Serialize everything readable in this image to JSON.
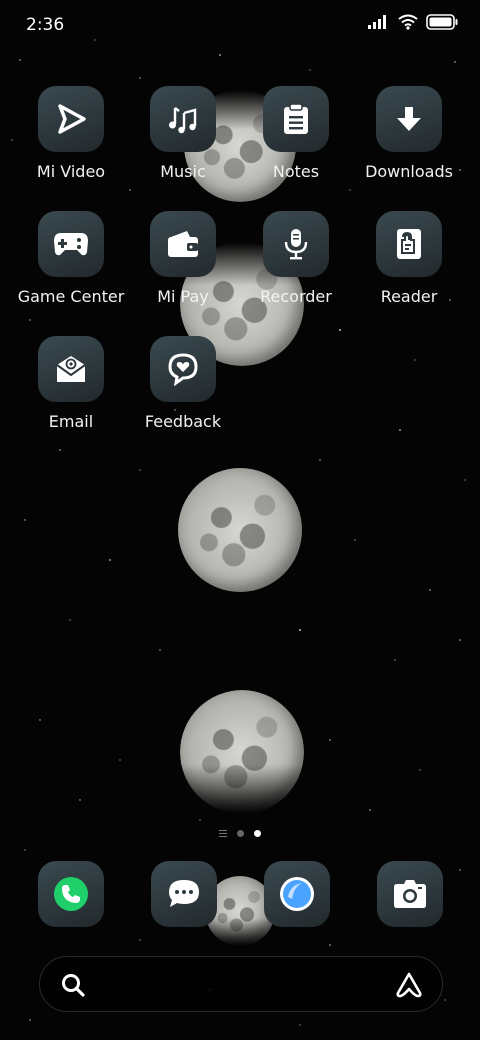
{
  "status_bar": {
    "time": "2:36",
    "icons": [
      "signal-icon",
      "wifi-icon",
      "battery-icon"
    ]
  },
  "home": {
    "apps": [
      {
        "label": "Mi Video",
        "icon": "play-icon"
      },
      {
        "label": "Music",
        "icon": "music-note-icon"
      },
      {
        "label": "Notes",
        "icon": "clipboard-icon"
      },
      {
        "label": "Downloads",
        "icon": "download-arrow-icon"
      },
      {
        "label": "Game Center",
        "icon": "gamepad-icon"
      },
      {
        "label": "Mi Pay",
        "icon": "wallet-icon"
      },
      {
        "label": "Recorder",
        "icon": "microphone-icon"
      },
      {
        "label": "Reader",
        "icon": "book-icon"
      },
      {
        "label": "Email",
        "icon": "email-icon"
      },
      {
        "label": "Feedback",
        "icon": "feedback-heart-icon"
      }
    ],
    "page_indicator": {
      "pages": 2,
      "active": 2
    }
  },
  "dock": [
    {
      "name": "phone",
      "icon": "phone-icon",
      "color": "#1fcf6a"
    },
    {
      "name": "messages",
      "icon": "chat-bubble-icon",
      "color": "#ffffff"
    },
    {
      "name": "browser",
      "icon": "browser-icon",
      "color": "#4aa3ff"
    },
    {
      "name": "camera",
      "icon": "camera-icon",
      "color": "#ffffff"
    }
  ],
  "search": {
    "placeholder": ""
  },
  "colors": {
    "icon_tile": "#2d383d",
    "background": "#040404"
  }
}
